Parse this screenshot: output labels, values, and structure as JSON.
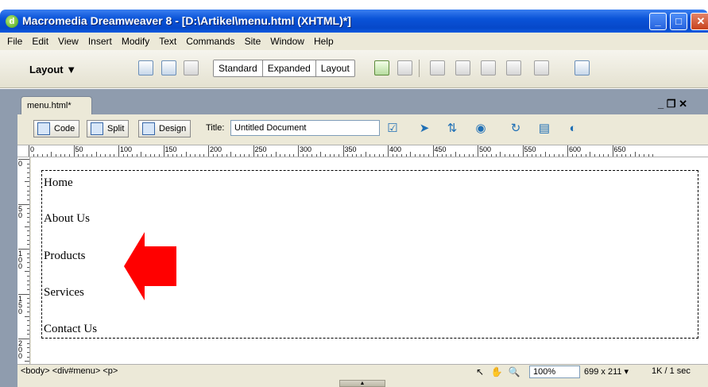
{
  "window": {
    "title": "Macromedia Dreamweaver 8 - [D:\\Artikel\\menu.html (XHTML)*]",
    "app_icon": "dreamweaver-icon",
    "buttons": [
      "minimize-icon",
      "maximize-icon",
      "close-icon"
    ]
  },
  "menubar": {
    "items": [
      "File",
      "Edit",
      "View",
      "Insert",
      "Modify",
      "Text",
      "Commands",
      "Site",
      "Window",
      "Help"
    ]
  },
  "insertbar": {
    "category": "Layout ▼",
    "modes": [
      "Standard",
      "Expanded",
      "Layout"
    ],
    "active_mode": "Standard"
  },
  "document": {
    "tab_label": "menu.html*",
    "window_controls": "_ ❐ ✕",
    "views": {
      "code": "Code",
      "split": "Split",
      "design": "Design"
    },
    "title_label": "Title:",
    "title_value": "Untitled Document"
  },
  "ruler": {
    "h_labels": [
      "0",
      "50",
      "100",
      "150",
      "200",
      "250",
      "300",
      "350",
      "400",
      "450",
      "500",
      "550",
      "600",
      "650"
    ],
    "v_labels": [
      "0",
      "50",
      "100",
      "150",
      "200"
    ]
  },
  "content": {
    "menu_items": [
      "Home",
      "About Us",
      "Products",
      "Services",
      "Contact Us"
    ]
  },
  "annotation": {
    "arrow_color": "#ff0000",
    "direction": "left"
  },
  "statusbar": {
    "tag_selector": "<body> <div#menu> <p>",
    "zoom": "100%",
    "window_size": "699 x 211 ▾",
    "download": "1K / 1 sec"
  }
}
